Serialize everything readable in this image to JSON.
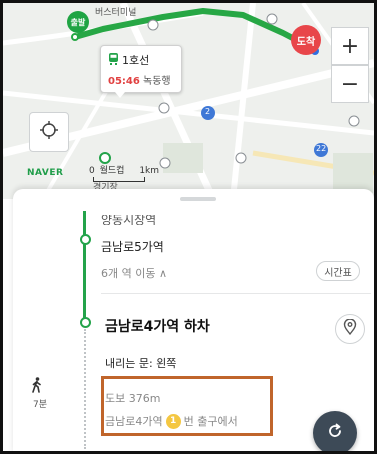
{
  "map": {
    "start_pin": "출발",
    "end_pin": "도착",
    "top_label": "버스터미널",
    "naver_logo": "NAVER",
    "scale_prefix": "0",
    "scale_place": "월드컵",
    "scale_distance": "1km",
    "place_label": "경기장",
    "route_color": "#27a745",
    "zoom_in": "+",
    "zoom_out": "−",
    "bus_badge_2": "2",
    "bus_badge_22": "22"
  },
  "bubble": {
    "line": "1호선",
    "time": "05:46",
    "direction": "녹동행"
  },
  "route": {
    "station_top_partial": "양동시장역",
    "station_prev": "금남로5가역",
    "moves_label": "6개 역 이동 ∧",
    "timetable_button": "시간표",
    "alight_station": "금남로4가역 하차",
    "door_side": "내리는 문: 왼쪽",
    "walk_minutes": "7분",
    "walk_distance": "도보 376m",
    "exit_station": "금남로4가역",
    "exit_number": "1",
    "exit_suffix": "번 출구에서"
  },
  "colors": {
    "subway_line": "#23a34a",
    "exit_badge": "#f4c742",
    "highlight_box": "#c0652b",
    "fab": "#3d4a57"
  }
}
